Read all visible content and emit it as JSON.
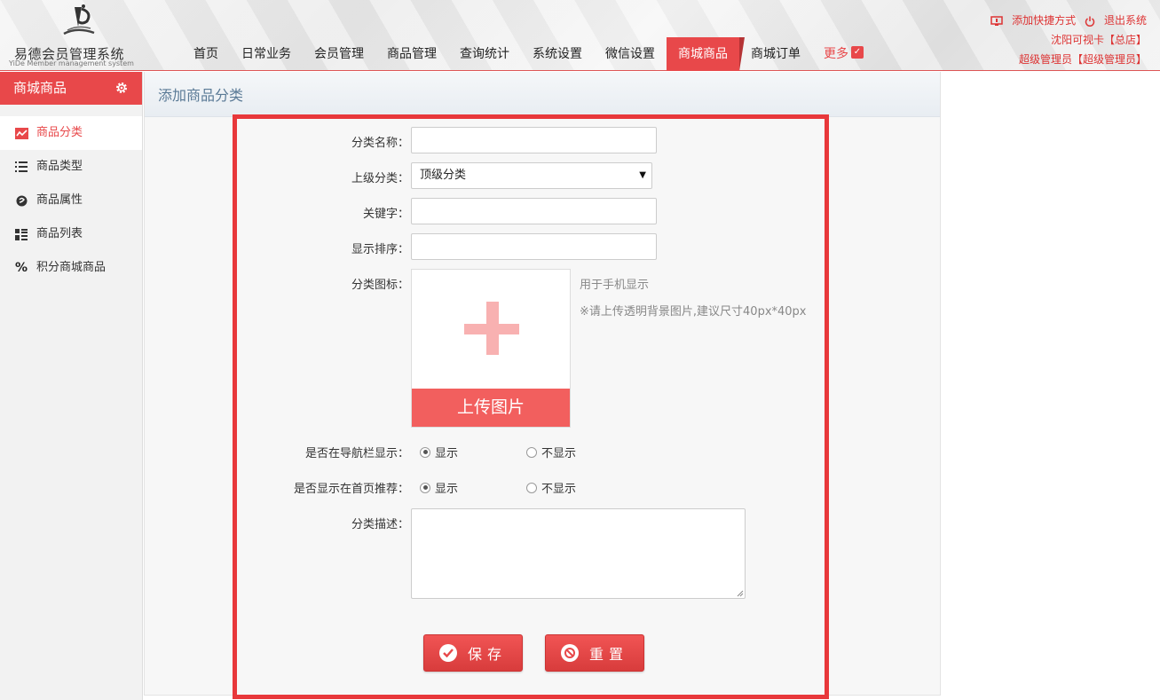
{
  "header": {
    "logo_title": "易德会员管理系统",
    "logo_subtitle": "YiDe Member management system",
    "nav": [
      {
        "label": "首页",
        "active": false
      },
      {
        "label": "日常业务",
        "active": false
      },
      {
        "label": "会员管理",
        "active": false
      },
      {
        "label": "商品管理",
        "active": false
      },
      {
        "label": "查询统计",
        "active": false
      },
      {
        "label": "系统设置",
        "active": false
      },
      {
        "label": "微信设置",
        "active": false
      },
      {
        "label": "商城商品",
        "active": true
      },
      {
        "label": "商城订单",
        "active": false
      }
    ],
    "more_label": "更多",
    "add_shortcut": "添加快捷方式",
    "logout": "退出系统",
    "store": "沈阳可视卡【总店】",
    "user": "超级管理员【超级管理员】"
  },
  "sidebar": {
    "title": "商城商品",
    "items": [
      {
        "label": "商品分类",
        "icon": "chart-icon",
        "active": true
      },
      {
        "label": "商品类型",
        "icon": "list-icon",
        "active": false
      },
      {
        "label": "商品属性",
        "icon": "tag-icon",
        "active": false
      },
      {
        "label": "商品列表",
        "icon": "grid-icon",
        "active": false
      },
      {
        "label": "积分商城商品",
        "icon": "percent-icon",
        "active": false
      }
    ]
  },
  "main": {
    "breadcrumb": "添加商品分类",
    "form": {
      "name_label": "分类名称：",
      "name_value": "",
      "parent_label": "上级分类：",
      "parent_value": "顶级分类",
      "keyword_label": "关键字：",
      "keyword_value": "",
      "sort_label": "显示排序：",
      "sort_value": "",
      "icon_label": "分类图标：",
      "upload_label": "上传图片",
      "hint1": "用于手机显示",
      "hint2": "※请上传透明背景图片,建议尺寸40px*40px",
      "nav_show_label": "是否在导航栏显示：",
      "nav_show_options": [
        "显示",
        "不显示"
      ],
      "nav_show_selected": "显示",
      "home_show_label": "是否显示在首页推荐：",
      "home_show_options": [
        "显示",
        "不显示"
      ],
      "home_show_selected": "显示",
      "desc_label": "分类描述：",
      "desc_value": ""
    },
    "save_label": "保存",
    "reset_label": "重置"
  },
  "colors": {
    "accent": "#e8484a",
    "highlight_border": "#e8383b",
    "upload_button": "#f25f5e"
  }
}
